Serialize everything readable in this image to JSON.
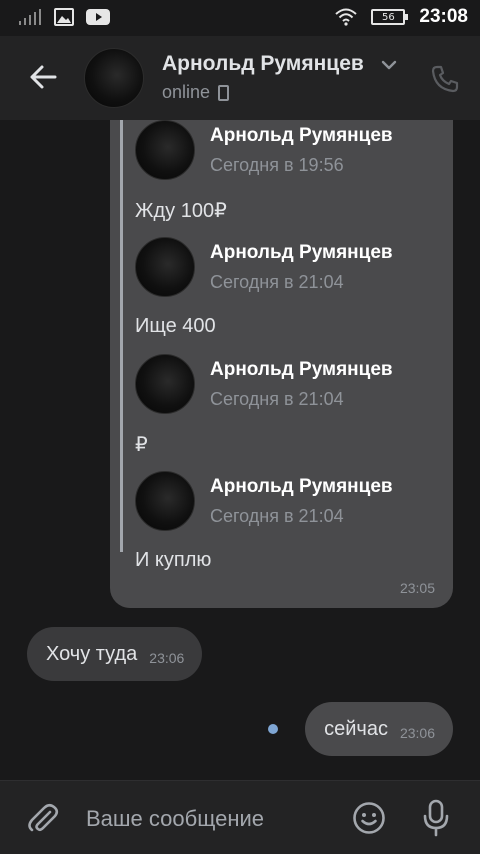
{
  "status_bar": {
    "time": "23:08",
    "battery": "56",
    "icons": [
      "signal-icon",
      "image-icon",
      "youtube-icon",
      "wifi-icon",
      "battery-icon"
    ]
  },
  "header": {
    "name": "Арнольд Румянцев",
    "status": "online",
    "icons": [
      "back-arrow-icon",
      "chevron-down-icon",
      "mobile-device-icon",
      "call-icon"
    ]
  },
  "forwarded": {
    "items": [
      {
        "sender": "Арнольд Румянцев",
        "time": "Сегодня в 19:56",
        "text": "Жду 100₽"
      },
      {
        "sender": "Арнольд Румянцев",
        "time": "Сегодня в 21:04",
        "text": "Ище 400"
      },
      {
        "sender": "Арнольд Румянцев",
        "time": "Сегодня в 21:04",
        "text": "₽"
      },
      {
        "sender": "Арнольд Румянцев",
        "time": "Сегодня в 21:04",
        "text": "И куплю"
      }
    ],
    "time": "23:05"
  },
  "messages": [
    {
      "direction": "incoming",
      "text": "Хочу туда",
      "time": "23:06"
    },
    {
      "direction": "outgoing",
      "text": "сейчас",
      "time": "23:06"
    }
  ],
  "composer": {
    "placeholder": "Ваше сообщение",
    "icons": [
      "attach-icon",
      "emoji-icon",
      "microphone-icon"
    ]
  },
  "colors": {
    "background": "#19191a",
    "header": "#232324",
    "bubble_in": "#3a3a3c",
    "bubble_out": "#4a4a4c",
    "unread_dot": "#7fa6d4"
  }
}
